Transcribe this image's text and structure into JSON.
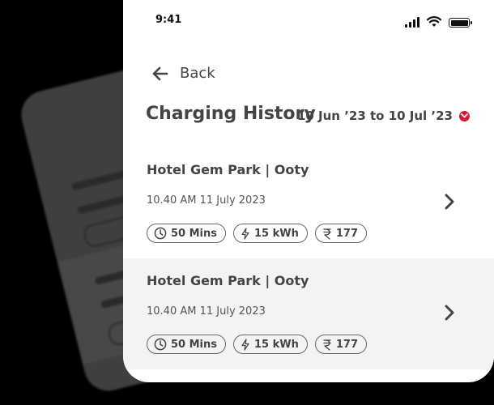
{
  "status_bar": {
    "time": "9:41",
    "icons": [
      "signal-icon",
      "wifi-icon",
      "battery-icon"
    ]
  },
  "header": {
    "back_label": "Back",
    "title": "Charging History",
    "date_range": "10 Jun ’23 to 10 Jul ’23"
  },
  "sessions": [
    {
      "station": "Hotel Gem Park | Ooty",
      "datetime": "10.40 AM  11 July 2023",
      "duration": "50 Mins",
      "energy": "15 kWh",
      "amount": "177"
    },
    {
      "station": "Hotel Gem Park | Ooty",
      "datetime": "10.40 AM  11 July 2023",
      "duration": "50 Mins",
      "energy": "15 kWh",
      "amount": "177"
    }
  ],
  "colors": {
    "accent": "#d8163b",
    "text": "#444444",
    "alt_row": "#f3f3f3"
  }
}
